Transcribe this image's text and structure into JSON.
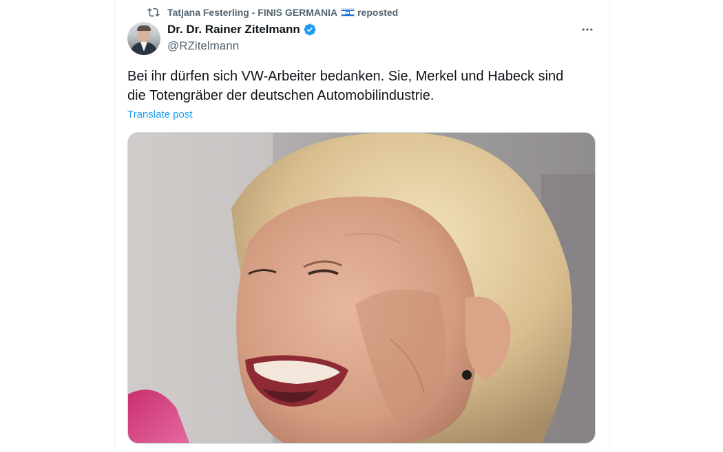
{
  "repost": {
    "reposter_name": "Tatjana Festerling - FINIS GERMANIA",
    "flag_icon": "israel-flag-icon",
    "reposted_label": "reposted",
    "icon": "repost-icon"
  },
  "post": {
    "author": {
      "display_name": "Dr. Dr. Rainer Zitelmann",
      "handle": "@RZitelmann",
      "verified_icon": "verified-badge-icon",
      "verified_color": "#1d9bf0"
    },
    "more_icon": "more-icon",
    "text": "Bei ihr dürfen sich VW-Arbeiter bedanken. Sie, Merkel und Habeck sind\ndie Totengräber der deutschen Automobilindustrie.",
    "translate_label": "Translate post",
    "link_color": "#1d9bf0"
  }
}
